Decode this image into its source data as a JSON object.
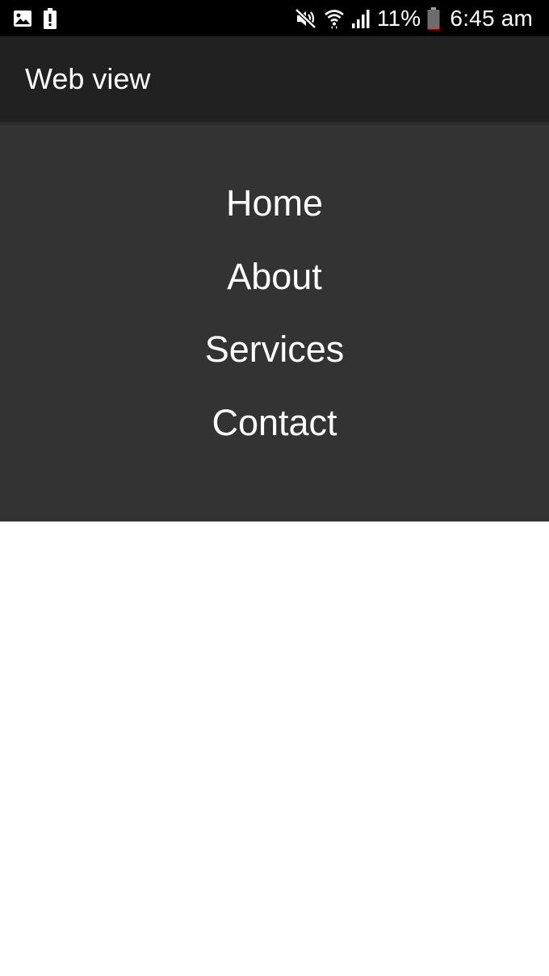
{
  "status_bar": {
    "battery_percent_text": "11%",
    "time_text": "6:45 am",
    "left_icons": [
      "image-notification-icon",
      "battery-alert-icon"
    ],
    "right_icons": [
      "mute-icon",
      "wifi-icon",
      "signal-icon",
      "battery-icon"
    ],
    "battery_level": 0.11,
    "battery_low_color": "#e53935"
  },
  "app_bar": {
    "title": "Web view",
    "background_color": "#212121"
  },
  "web_menu": {
    "background_color": "#333333",
    "items": [
      {
        "label": "Home"
      },
      {
        "label": "About"
      },
      {
        "label": "Services"
      },
      {
        "label": "Contact"
      }
    ]
  }
}
